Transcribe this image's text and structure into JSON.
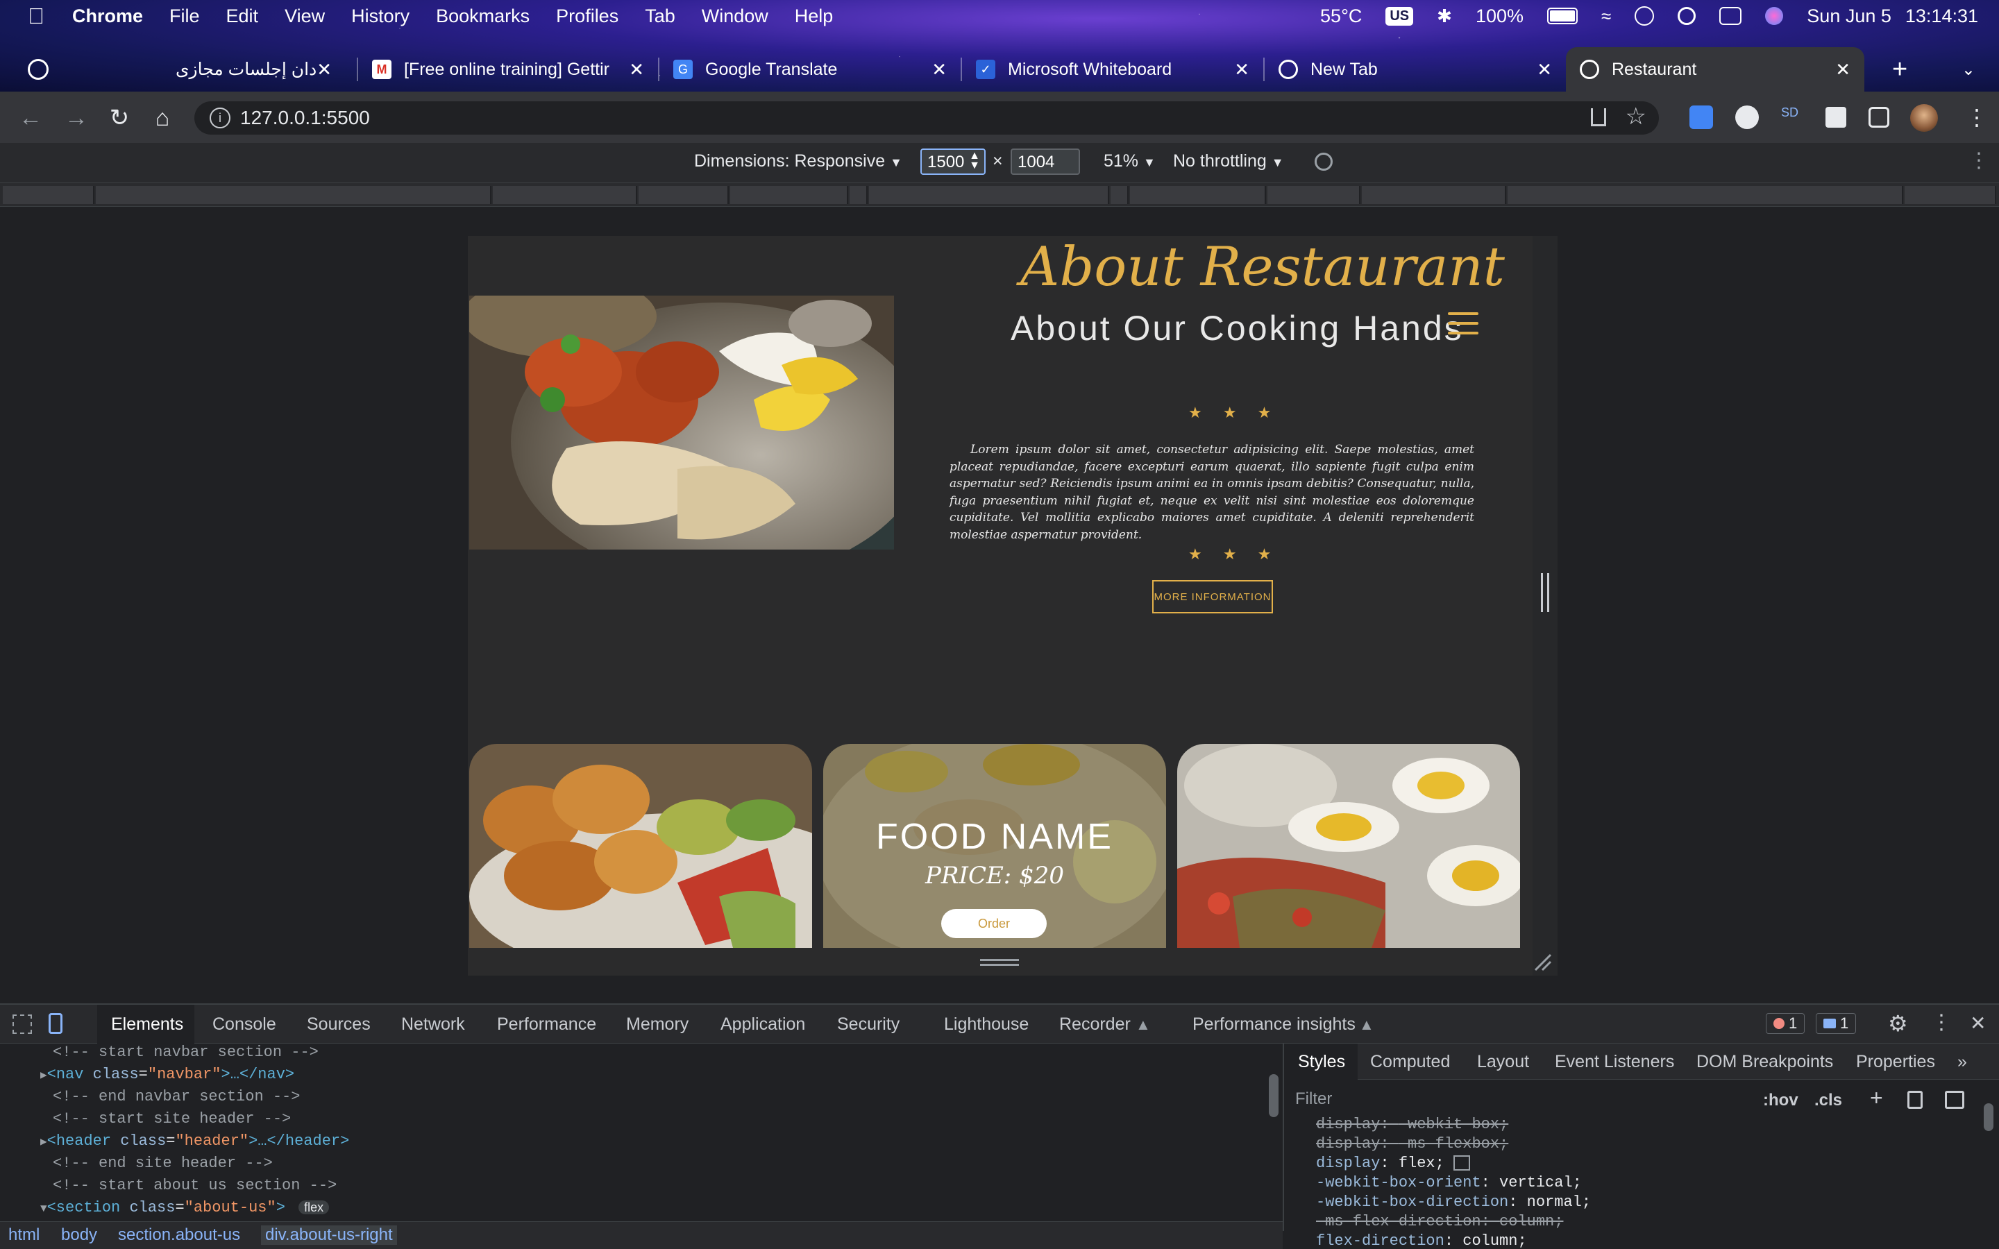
{
  "menubar": {
    "app": "Chrome",
    "items": [
      "File",
      "Edit",
      "View",
      "History",
      "Bookmarks",
      "Profiles",
      "Tab",
      "Window",
      "Help"
    ],
    "status": {
      "temperature": "55°C",
      "input_source": "US",
      "battery": "100%",
      "date": "Sun Jun 5",
      "time": "13:14:31"
    }
  },
  "tabs": [
    {
      "label": "دان إجلسات مجازى",
      "icon": "globe-icon"
    },
    {
      "label": "[Free online training] Gettir",
      "icon": "gmail-icon"
    },
    {
      "label": "Google Translate",
      "icon": "translate-icon"
    },
    {
      "label": "Microsoft Whiteboard",
      "icon": "whiteboard-icon"
    },
    {
      "label": "New Tab",
      "icon": "globe-icon"
    },
    {
      "label": "Restaurant",
      "icon": "globe-icon",
      "active": true
    }
  ],
  "toolbar": {
    "url": "127.0.0.1:5500"
  },
  "device_toolbar": {
    "dimensions_label": "Dimensions: Responsive",
    "width": "1500",
    "height": "1004",
    "times": "×",
    "zoom": "51%",
    "throttling": "No throttling"
  },
  "page": {
    "title": "About Restaurant",
    "subtitle": "About Our Cooking Hands",
    "stars": "★ ★ ★",
    "lorem": "Lorem ipsum dolor sit amet, consectetur adipisicing elit. Saepe molestias, amet placeat repudiandae, facere excepturi earum quaerat, illo sapiente fugit culpa enim aspernatur sed? Reiciendis ipsum animi ea in omnis ipsam debitis? Consequatur, nulla, fuga praesentium nihil fugiat et, neque ex velit nisi sint molestiae eos doloremque cupiditate. Vel mollitia explicabo maiores amet cupiditate. A deleniti reprehenderit molestiae aspernatur provident.",
    "more_button": "MORE INFORMATION",
    "card": {
      "food_name": "FOOD NAME",
      "price": "PRICE: $20",
      "order_button": "Order"
    }
  },
  "devtools": {
    "tabs": [
      "Elements",
      "Console",
      "Sources",
      "Network",
      "Performance",
      "Memory",
      "Application",
      "Security",
      "Lighthouse",
      "Recorder",
      "Performance insights"
    ],
    "errors": "1",
    "messages": "1",
    "code_lines": [
      {
        "type": "comment",
        "text": "<!-- start navbar section -->"
      },
      {
        "type": "element",
        "open": "<nav",
        "attr": "class",
        "value": "\"navbar\"",
        "rest": ">…</nav>"
      },
      {
        "type": "comment",
        "text": "<!-- end navbar section -->"
      },
      {
        "type": "comment",
        "text": "<!-- start site header -->"
      },
      {
        "type": "element",
        "open": "<header",
        "attr": "class",
        "value": "\"header\"",
        "rest": ">…</header>"
      },
      {
        "type": "comment",
        "text": "<!-- end site header -->"
      },
      {
        "type": "comment",
        "text": "<!-- start about us section -->"
      },
      {
        "type": "element",
        "open": "<section",
        "attr": "class",
        "value": "\"about-us\"",
        "rest": ">",
        "badge": "flex"
      }
    ],
    "breadcrumbs": [
      "html",
      "body",
      "section.about-us",
      "div.about-us-right"
    ],
    "styles_tabs": [
      "Styles",
      "Computed",
      "Layout",
      "Event Listeners",
      "DOM Breakpoints",
      "Properties"
    ],
    "filter_placeholder": "Filter",
    "hov": ":hov",
    "cls": ".cls",
    "css_lines": [
      {
        "prop": "display",
        "value": "-webkit-box;",
        "struck": true
      },
      {
        "prop": "display",
        "value": "-ms-flexbox;",
        "struck": true
      },
      {
        "prop": "display",
        "value": "flex;",
        "struck": false
      },
      {
        "prop": "-webkit-box-orient",
        "value": "vertical;",
        "struck": false
      },
      {
        "prop": "-webkit-box-direction",
        "value": "normal;",
        "struck": false
      },
      {
        "prop": "-ms-flex-direction",
        "value": "column;",
        "struck": true
      },
      {
        "prop": "flex-direction",
        "value": "column;",
        "struck": false
      }
    ]
  },
  "colors": {
    "accent_gold": "#e2b04a",
    "devtools_bg": "#202124",
    "toolbar_bg": "#35363a"
  }
}
